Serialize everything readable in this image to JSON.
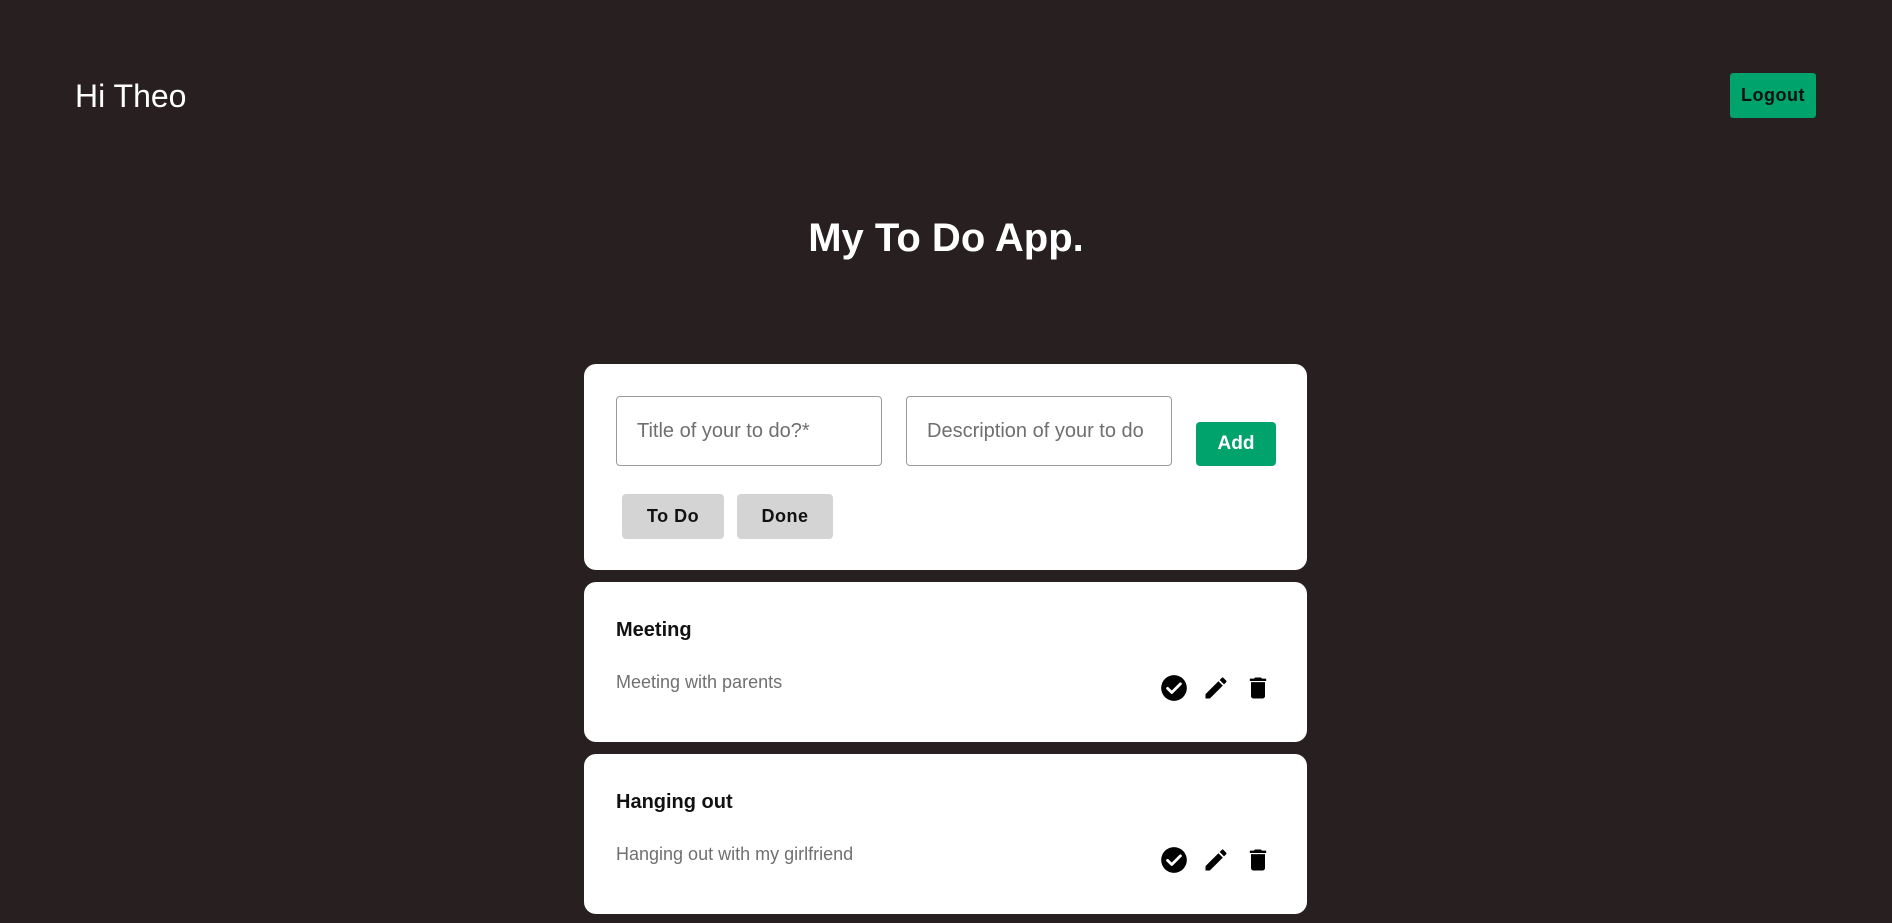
{
  "header": {
    "greeting": "Hi Theo",
    "logout_label": "Logout"
  },
  "app_title": "My To Do App.",
  "form": {
    "title_placeholder": "Title of your to do?*",
    "title_value": "",
    "description_placeholder": "Description of your to do",
    "description_value": "",
    "add_label": "Add",
    "filters": [
      {
        "label": "To Do"
      },
      {
        "label": "Done"
      }
    ]
  },
  "todos": [
    {
      "title": "Meeting",
      "description": "Meeting with parents"
    },
    {
      "title": "Hanging out",
      "description": "Hanging out with my girlfriend"
    }
  ],
  "icons": {
    "complete": "check-circle-icon",
    "edit": "pencil-icon",
    "delete": "trash-icon"
  },
  "colors": {
    "background": "#271f20",
    "accent": "#00a36c",
    "card": "#ffffff",
    "filter_button": "#d4d4d4"
  }
}
